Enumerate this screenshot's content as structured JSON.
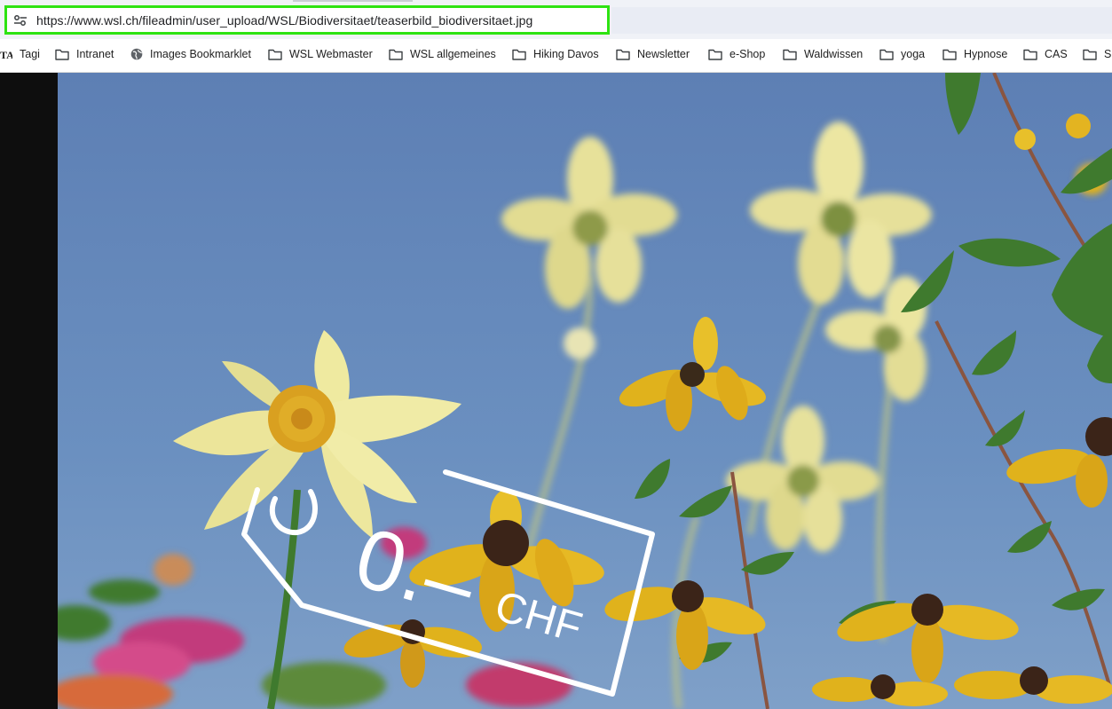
{
  "browser": {
    "url": "https://www.wsl.ch/fileadmin/user_upload/WSL/Biodiversitaet/teaserbild_biodiversitaet.jpg",
    "highlight_color": "#2ee312"
  },
  "bookmarks": [
    {
      "label": "Tagi",
      "icon": "tagi-favicon-icon"
    },
    {
      "label": "Intranet",
      "icon": "folder-icon"
    },
    {
      "label": "Images Bookmarklet",
      "icon": "globe-icon"
    },
    {
      "label": "WSL Webmaster",
      "icon": "folder-icon"
    },
    {
      "label": "WSL allgemeines",
      "icon": "folder-icon"
    },
    {
      "label": "Hiking Davos",
      "icon": "folder-icon"
    },
    {
      "label": "Newsletter",
      "icon": "folder-icon"
    },
    {
      "label": "e-Shop",
      "icon": "folder-icon"
    },
    {
      "label": "Waldwissen",
      "icon": "folder-icon"
    },
    {
      "label": "yoga",
      "icon": "folder-icon"
    },
    {
      "label": "Hypnose",
      "icon": "folder-icon"
    },
    {
      "label": "CAS",
      "icon": "folder-icon"
    },
    {
      "label": "Sp",
      "icon": "folder-icon"
    }
  ],
  "image": {
    "price_tag": {
      "amount": "0.–",
      "currency": "CHF"
    },
    "colors": {
      "sky": "#5f86b8",
      "petal_pale": "#efeaa0",
      "petal_gold": "#e0b21c",
      "leaf": "#3f7a2e"
    }
  }
}
